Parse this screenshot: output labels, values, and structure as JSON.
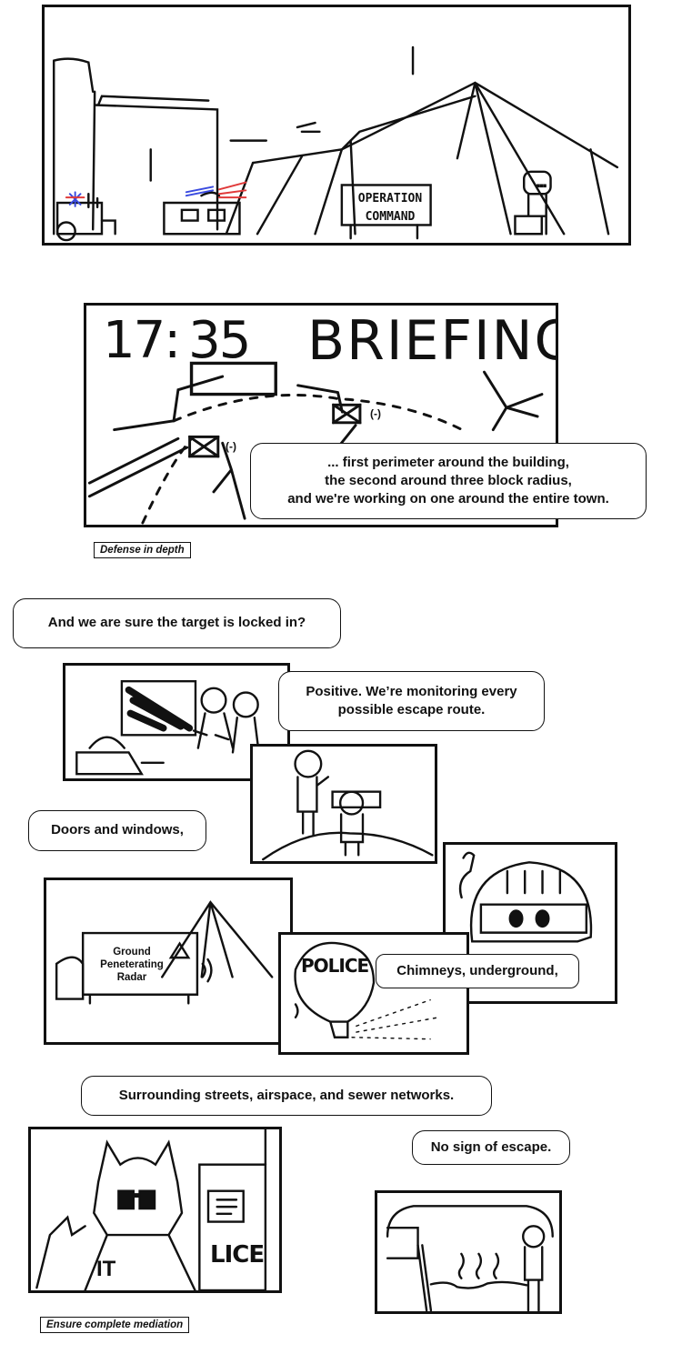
{
  "panel1": {
    "sign_line1": "OPERATION",
    "sign_line2": "COMMAND"
  },
  "panel2": {
    "clock_hour": "17:",
    "clock_min": "35",
    "heading": "BRIEFING",
    "map_mark": "(-)",
    "bubble": "... first perimeter around the building,\nthe second around three block radius,\nand we're working on one around the entire town."
  },
  "caption1": "Defense in depth",
  "bubble_locked": "And we are sure the target is locked in?",
  "bubble_positive": "Positive. We’re monitoring every possible escape route.",
  "bubble_doors": "Doors and windows,",
  "gpr_sign": {
    "line1": "Ground",
    "line2": "Peneterating",
    "line3": "Radar"
  },
  "police_balloon": "POLICE",
  "bubble_chimneys": "Chimneys, underground,",
  "bubble_streets": "Surrounding streets, airspace, and sewer networks.",
  "bubble_nosign": "No sign of escape.",
  "police_sign_fragment": "LICE",
  "caption2": "Ensure complete mediation",
  "colors": {
    "ink": "#111111",
    "paper": "#ffffff",
    "siren_red": "#e03a3a",
    "siren_blue": "#3a4be0"
  }
}
